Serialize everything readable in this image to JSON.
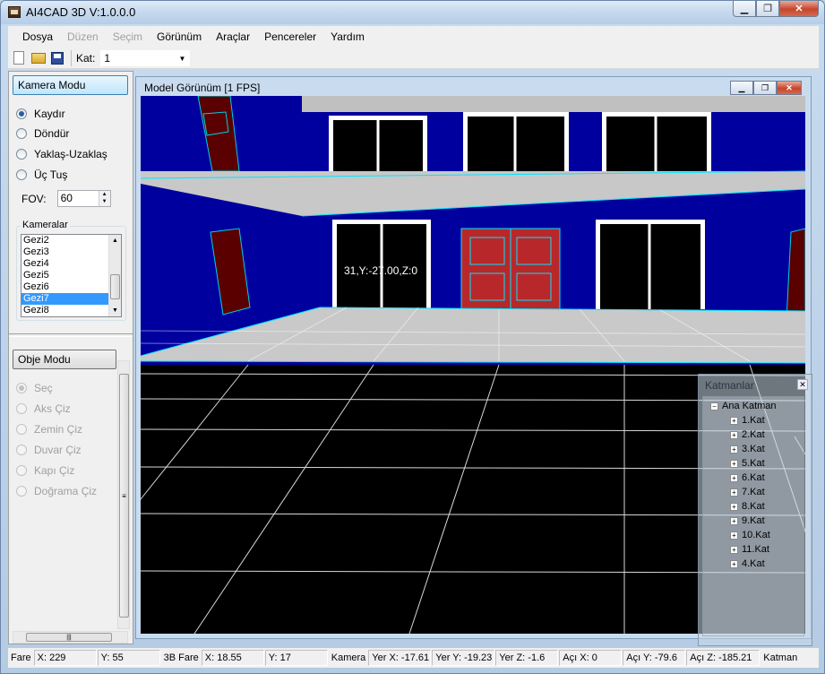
{
  "window": {
    "title": "AI4CAD 3D V:1.0.0.0"
  },
  "menu": [
    {
      "label": "Dosya",
      "enabled": true
    },
    {
      "label": "Düzen",
      "enabled": false
    },
    {
      "label": "Seçim",
      "enabled": false
    },
    {
      "label": "Görünüm",
      "enabled": true
    },
    {
      "label": "Araçlar",
      "enabled": true
    },
    {
      "label": "Pencereler",
      "enabled": true
    },
    {
      "label": "Yardım",
      "enabled": true
    }
  ],
  "toolbar": {
    "kat_label": "Kat:",
    "kat_value": "1"
  },
  "camera_panel": {
    "header": "Kamera Modu",
    "modes": [
      "Kaydır",
      "Döndür",
      "Yaklaş-Uzaklaş",
      "Üç Tuş"
    ],
    "selected_mode": "Kaydır",
    "fov_label": "FOV:",
    "fov_value": "60",
    "cameras_label": "Kameralar",
    "cameras": [
      "Gezi2",
      "Gezi3",
      "Gezi4",
      "Gezi5",
      "Gezi6",
      "Gezi7",
      "Gezi8"
    ],
    "selected_camera": "Gezi7"
  },
  "object_panel": {
    "header": "Obje Modu",
    "tools": [
      "Seç",
      "Aks Çiz",
      "Zemin Çiz",
      "Duvar Çiz",
      "Kapı Çiz",
      "Doğrama Çiz"
    ],
    "selected_tool": "Seç"
  },
  "model_view": {
    "title": "Model Görünüm [1 FPS]",
    "overlay_text": "31,Y:-27.00,Z:0"
  },
  "layers": {
    "title": "Katmanlar",
    "root": "Ana Katman",
    "items": [
      "1.Kat",
      "2.Kat",
      "3.Kat",
      "5.Kat",
      "6.Kat",
      "7.Kat",
      "8.Kat",
      "9.Kat",
      "10.Kat",
      "11.Kat",
      "4.Kat"
    ]
  },
  "statusbar": {
    "fare_label": "Fare",
    "fare_x": "X: 229",
    "fare_y": "Y: 55",
    "fare3d_label": "3B Fare",
    "fare3d_x": "X: 18.55",
    "fare3d_y": "Y: 17",
    "kamera_label": "Kamera",
    "yer_x": "Yer X: -17.61",
    "yer_y": "Yer Y: -19.23",
    "yer_z": "Yer Z: -1.6",
    "aci_x": "Açı X: 0",
    "aci_y": "Açı Y: -79.6",
    "aci_z": "Açı Z: -185.21",
    "katman_label": "Katman"
  }
}
